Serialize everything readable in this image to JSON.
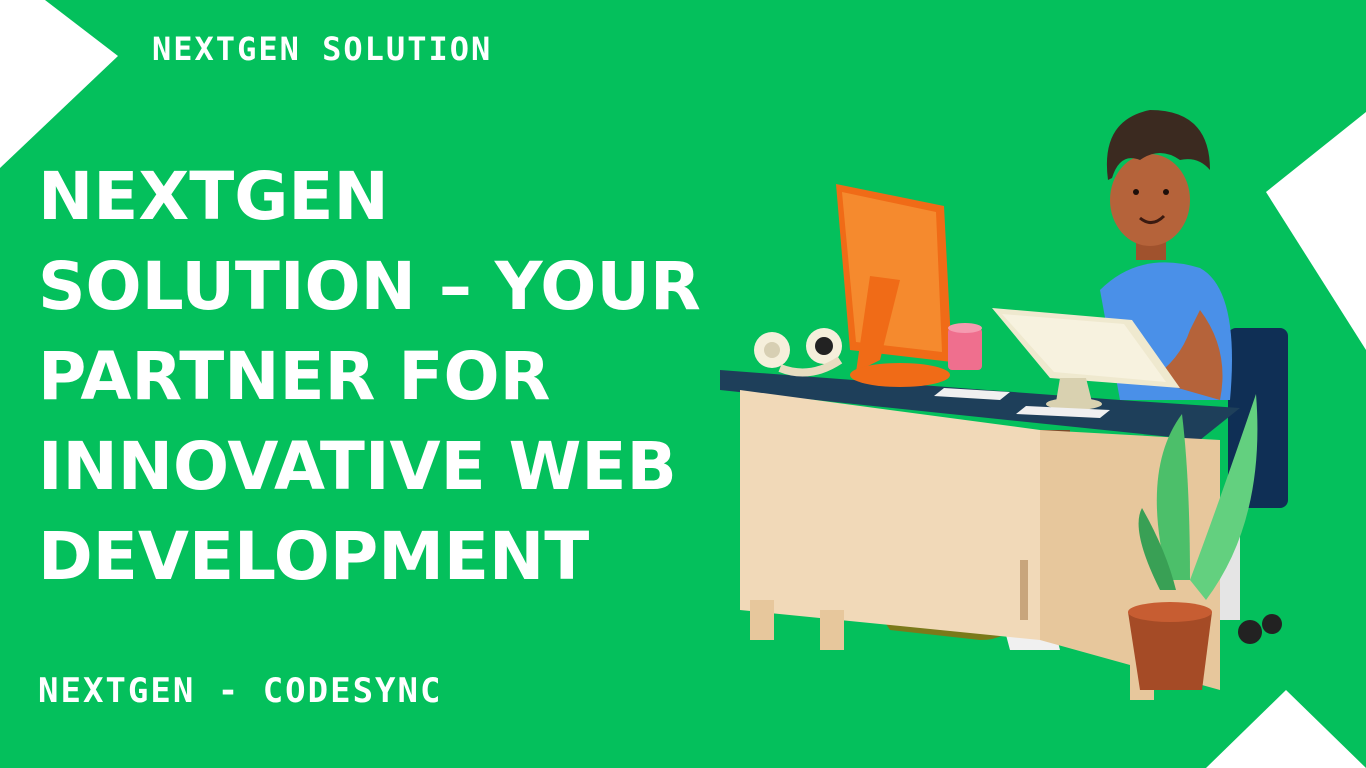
{
  "brand": {
    "top_label": "NEXTGEN SOLUTION",
    "bottom_label": "NEXTGEN - CODESYNC"
  },
  "headline": {
    "lines": [
      "NEXTGEN",
      "SOLUTION – YOUR",
      "PARTNER FOR",
      "INNOVATIVE WEB",
      "DEVELOPMENT"
    ]
  },
  "colors": {
    "background": "#04c05c",
    "accent_shapes": "#ffffff",
    "text": "#ffffff"
  },
  "illustration": {
    "subject": "person-at-desk-with-computer",
    "items": [
      "orange-monitor-icon",
      "headphones-icon",
      "pink-mug-icon",
      "laptop-icon",
      "desk-icon",
      "chair-icon",
      "potted-plant-icon"
    ]
  }
}
